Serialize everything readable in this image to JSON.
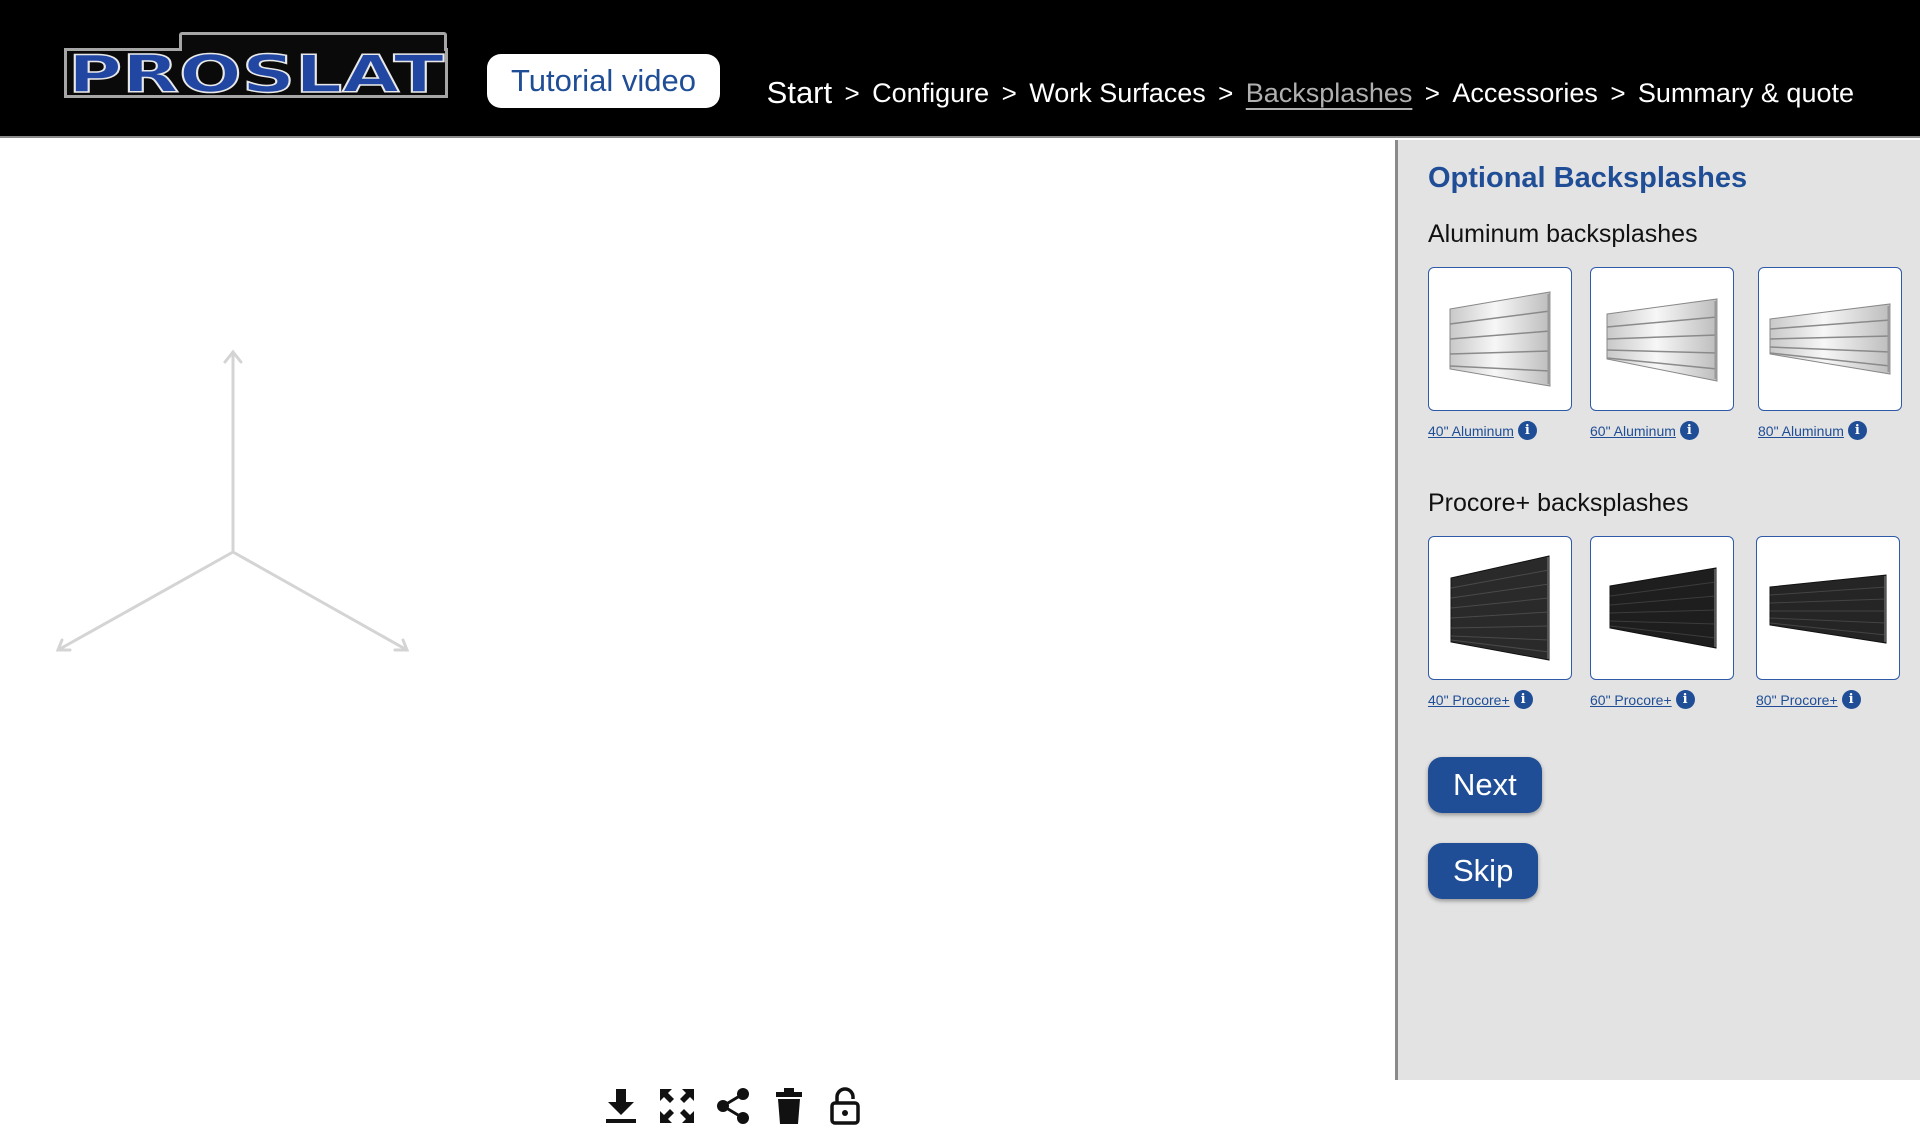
{
  "header": {
    "logo_text": "PROSLAT",
    "tutorial_label": "Tutorial video",
    "breadcrumbs": [
      {
        "label": "Start"
      },
      {
        "label": "Configure"
      },
      {
        "label": "Work Surfaces"
      },
      {
        "label": "Backsplashes",
        "active": true
      },
      {
        "label": "Accessories"
      },
      {
        "label": "Summary & quote"
      }
    ],
    "separator": ">"
  },
  "toolbar": {
    "icons": [
      "download-icon",
      "fullscreen-icon",
      "share-icon",
      "trash-icon",
      "unlock-icon"
    ]
  },
  "panel": {
    "title": "Optional Backsplashes",
    "aluminum": {
      "title": "Aluminum backsplashes",
      "items": [
        {
          "label": "40\" Aluminum"
        },
        {
          "label": "60\" Aluminum"
        },
        {
          "label": "80\" Aluminum"
        }
      ]
    },
    "procore": {
      "title": "Procore+ backsplashes",
      "items": [
        {
          "label": "40\" Procore+"
        },
        {
          "label": "60\" Procore+"
        },
        {
          "label": "80\" Procore+"
        }
      ]
    },
    "info_glyph": "i",
    "next_label": "Next",
    "skip_label": "Skip"
  },
  "colors": {
    "brand_blue": "#1f4e96",
    "header_bg": "#000000",
    "panel_bg": "#e3e3e3"
  }
}
